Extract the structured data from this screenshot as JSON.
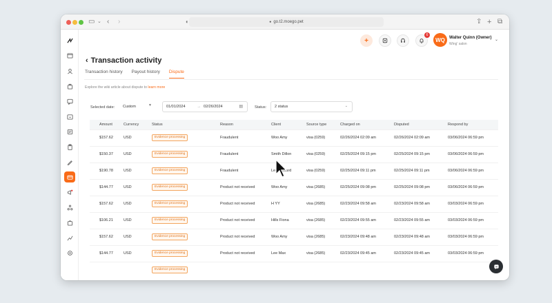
{
  "browser": {
    "url": "go.t2.moego.pet",
    "colors": {
      "close": "#ee5f57",
      "minimize": "#f5bd3e",
      "maximize": "#5fc444"
    }
  },
  "header": {
    "notification_count": "6",
    "avatar_initials": "WQ",
    "user_name": "Walter Quinn (Owner)",
    "business_name": "Wing' salon",
    "accent": "#f96b18"
  },
  "page": {
    "title": "Transaction activity",
    "tabs": [
      {
        "label": "Transaction history"
      },
      {
        "label": "Payout history"
      },
      {
        "label": "Dispute",
        "active": true
      }
    ],
    "wiki_text": "Explore the wiki article about dispute to ",
    "wiki_link": "learn more"
  },
  "filters": {
    "selected_date_label": "Selected date:",
    "date_mode": "Custom",
    "start_date": "01/01/2024",
    "end_date": "02/26/2024",
    "status_label": "Status:",
    "status_value": "2 status"
  },
  "table": {
    "columns": [
      "Amount",
      "Currency",
      "Status",
      "Reason",
      "Client",
      "Source type",
      "Charged on",
      "Disputed",
      "Respond by"
    ],
    "rows": [
      [
        "$157.62",
        "USD",
        "Evidence processing",
        "Fraudulent",
        "Woo Amy",
        "visa (0259)",
        "02/26/2024 02:09 am",
        "02/26/2024 02:09 am",
        "03/06/2024 06:59 pm"
      ],
      [
        "$150.37",
        "USD",
        "Evidence processing",
        "Fraudulent",
        "Smith Dillon",
        "visa (0259)",
        "02/25/2024 09:15 pm",
        "02/25/2024 09:15 pm",
        "03/06/2024 06:59 pm"
      ],
      [
        "$190.78",
        "USD",
        "Evidence processing",
        "Fraudulent",
        "Lee Edward",
        "visa (0259)",
        "02/25/2024 09:11 pm",
        "02/25/2024 09:11 pm",
        "03/06/2024 06:59 pm"
      ],
      [
        "$144.77",
        "USD",
        "Evidence processing",
        "Product not received",
        "Woo Amy",
        "visa (2685)",
        "02/25/2024 09:08 pm",
        "02/25/2024 09:08 pm",
        "03/06/2024 06:59 pm"
      ],
      [
        "$157.62",
        "USD",
        "Evidence processing",
        "Product not received",
        "H YY",
        "visa (2685)",
        "02/23/2024 09:58 am",
        "02/23/2024 09:58 am",
        "03/03/2024 06:59 pm"
      ],
      [
        "$106.21",
        "USD",
        "Evidence processing",
        "Product not received",
        "Hills Fiona",
        "visa (2685)",
        "02/23/2024 09:55 am",
        "02/23/2024 09:55 am",
        "03/03/2024 06:59 pm"
      ],
      [
        "$157.62",
        "USD",
        "Evidence processing",
        "Product not received",
        "Woo Amy",
        "visa (2685)",
        "02/23/2024 09:48 am",
        "02/23/2024 09:48 am",
        "03/03/2024 06:59 pm"
      ],
      [
        "$144.77",
        "USD",
        "Evidence processing",
        "Product not received",
        "Lee Max",
        "visa (2685)",
        "02/23/2024 09:45 am",
        "02/23/2024 09:45 am",
        "03/03/2024 06:59 pm"
      ],
      [
        "",
        "",
        "Evidence processing",
        "",
        "",
        "",
        "",
        "",
        ""
      ]
    ]
  },
  "sidebar": {
    "icons": [
      "logo-icon",
      "calendar-icon",
      "client-icon",
      "briefcase-icon",
      "message-icon",
      "schedule-icon",
      "invoice-icon",
      "clipboard-icon",
      "pen-icon",
      "payment-icon",
      "megaphone-icon",
      "network-icon",
      "bag-icon",
      "chart-icon",
      "settings-icon"
    ]
  }
}
